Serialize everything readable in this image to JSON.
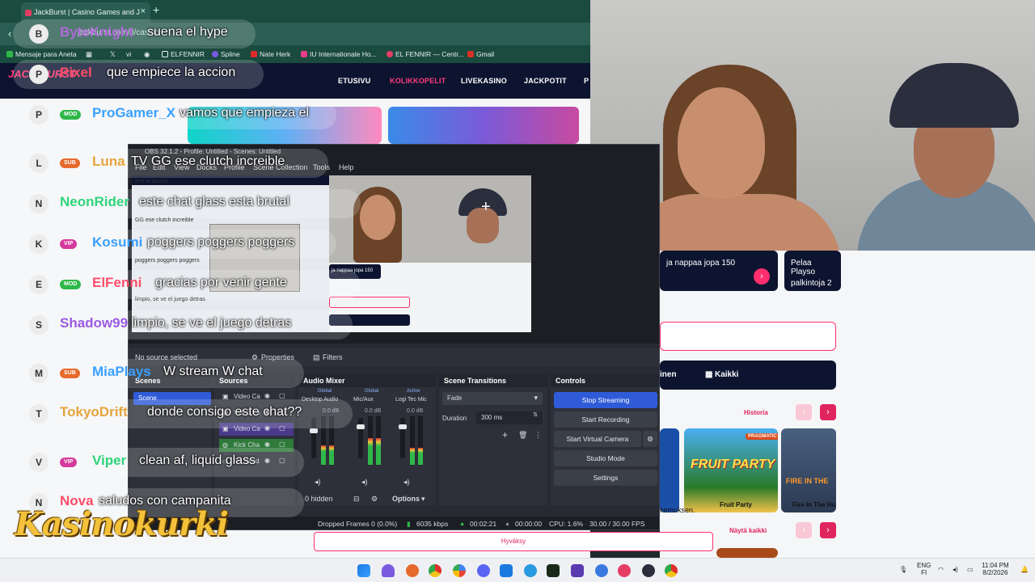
{
  "browser": {
    "tab_title": "JackBurst | Casino Games and J",
    "address_text": "jackburst.com/fi/casino",
    "bookmarks": [
      "Mensaje para Aneta",
      "ELFENNIR",
      "Spline",
      "Nate Herk",
      "IU Internationale Ho...",
      "EL FENNIR — Centr...",
      "Gmail"
    ]
  },
  "site": {
    "logo": "JACK BURST",
    "nav": [
      "ETUSIVU",
      "KOLIKKOPELIT",
      "LIVEKASINO",
      "JACKPOTIT",
      "P"
    ]
  },
  "right_site": {
    "promo1": "ja nappaa jopa 150",
    "promo2_line1": "Pelaa Playso",
    "promo2_line2": "palkintoja 2",
    "tab_partial": "inen",
    "tab_all": "Kaikki",
    "history_link": "Historia",
    "show_all_link": "Näytä kaikki",
    "games": [
      "Fruit Party",
      "Fire In The Ho"
    ],
    "game_brand": "PRAGMATIC",
    "game_art": "FRUIT PARTY",
    "game_art2": "FIRE IN THE",
    "cookie_text": "kemuksen.",
    "accept": "Hyväksy"
  },
  "obs": {
    "title": "OBS 32.1.2 - Profile: Untitled - Scenes: Untitled",
    "menu": [
      "File",
      "Edit",
      "View",
      "Docks",
      "Profile",
      "Scene Collection",
      "Tools",
      "Help"
    ],
    "no_source": "No source selected",
    "properties": "Properties",
    "filters": "Filters",
    "docks": {
      "scenes": "Scenes",
      "sources": "Sources",
      "audio_mixer": "Audio Mixer",
      "scene_transitions": "Scene Transitions",
      "controls": "Controls"
    },
    "scene_name": "Scene",
    "sources": [
      "Video Ca",
      "Video Ca",
      "Video Ca",
      "Kick Cha",
      "PC Wind"
    ],
    "mixer": {
      "channels": [
        "Desktop Audio",
        "Mic/Aux",
        "Logi Tec Mic"
      ],
      "tags": [
        "Global",
        "Global",
        "Active"
      ],
      "levels": [
        "0.0 dB",
        "0.0 dB",
        "0.0 dB"
      ],
      "meter_levels": [
        0.4,
        0.55,
        0.35
      ],
      "fader_levels": [
        0.7,
        0.82,
        0.82
      ],
      "hidden": "0 hidden",
      "options": "Options"
    },
    "transitions": {
      "selected": "Fade",
      "duration_label": "Duration",
      "duration_value": "300 ms"
    },
    "controls": [
      "Stop Streaming",
      "Start Recording",
      "Start Virtual Camera",
      "Studio Mode",
      "Settings"
    ],
    "status": {
      "dropped": "Dropped Frames 0 (0.0%)",
      "kbps": "6035 kbps",
      "stream_time": "00:02:21",
      "rec_time": "00:00:00",
      "cpu": "CPU: 1.6%",
      "fps": "30.00 / 30.00 FPS"
    },
    "preview_lines": [
      "ece la accion",
      "GG ese clutch increible",
      "poggers poggers poggers",
      "...",
      "limpio, se ve el juego detras",
      "ja nappaa jopa 150"
    ]
  },
  "chat": [
    {
      "initial": "B",
      "name": "ByteKnight",
      "badge": "",
      "badge_color": "",
      "name_color": "#b06ad8",
      "message": "suena el hype"
    },
    {
      "initial": "P",
      "name": "Pixel",
      "badge": "",
      "badge_color": "",
      "name_color": "#ff4d6a",
      "message": "que empiece la accion"
    },
    {
      "initial": "P",
      "name": "ProGamer_X",
      "badge": "MOD",
      "badge_color": "#2fb84a",
      "name_color": "#3aa0ff",
      "message": "vamos que empieza el"
    },
    {
      "initial": "L",
      "name": "Luna",
      "badge": "SUB",
      "badge_color": "#e66a2c",
      "name_color": "#e6a43c",
      "message": "TV GG ese clutch increible"
    },
    {
      "initial": "N",
      "name": "NeonRider",
      "badge": "",
      "badge_color": "",
      "name_color": "#2fd47a",
      "message": "este chat glass esta brutal"
    },
    {
      "initial": "K",
      "name": "Kosumi",
      "badge": "VIP",
      "badge_color": "#d63a9c",
      "name_color": "#3aa0ff",
      "message": "poggers poggers poggers"
    },
    {
      "initial": "E",
      "name": "ElFenni",
      "badge": "MOD",
      "badge_color": "#2fb84a",
      "name_color": "#ff4d6a",
      "message": "gracias por venir gente"
    },
    {
      "initial": "S",
      "name": "Shadow99",
      "badge": "",
      "badge_color": "",
      "name_color": "#9a5ae0",
      "message": "limpio, se ve el juego detras"
    },
    {
      "initial": "M",
      "name": "MiaPlays",
      "badge": "SUB",
      "badge_color": "#e66a2c",
      "name_color": "#3aa0ff",
      "message": "W stream W chat"
    },
    {
      "initial": "T",
      "name": "TokyoDrift",
      "badge": "",
      "badge_color": "",
      "name_color": "#e6a43c",
      "message": "donde consigo este chat??"
    },
    {
      "initial": "V",
      "name": "Viper",
      "badge": "VIP",
      "badge_color": "#d63a9c",
      "name_color": "#2fd47a",
      "message": "clean af, liquid glass"
    },
    {
      "initial": "N",
      "name": "Nova",
      "badge": "",
      "badge_color": "",
      "name_color": "#ff4d6a",
      "message": "saludos con campanita"
    }
  ],
  "logo_text": "Kasinokurki",
  "taskbar": {
    "lang1": "ENG",
    "lang2": "FI",
    "time": "11:04 PM",
    "date": "8/2/2026"
  }
}
